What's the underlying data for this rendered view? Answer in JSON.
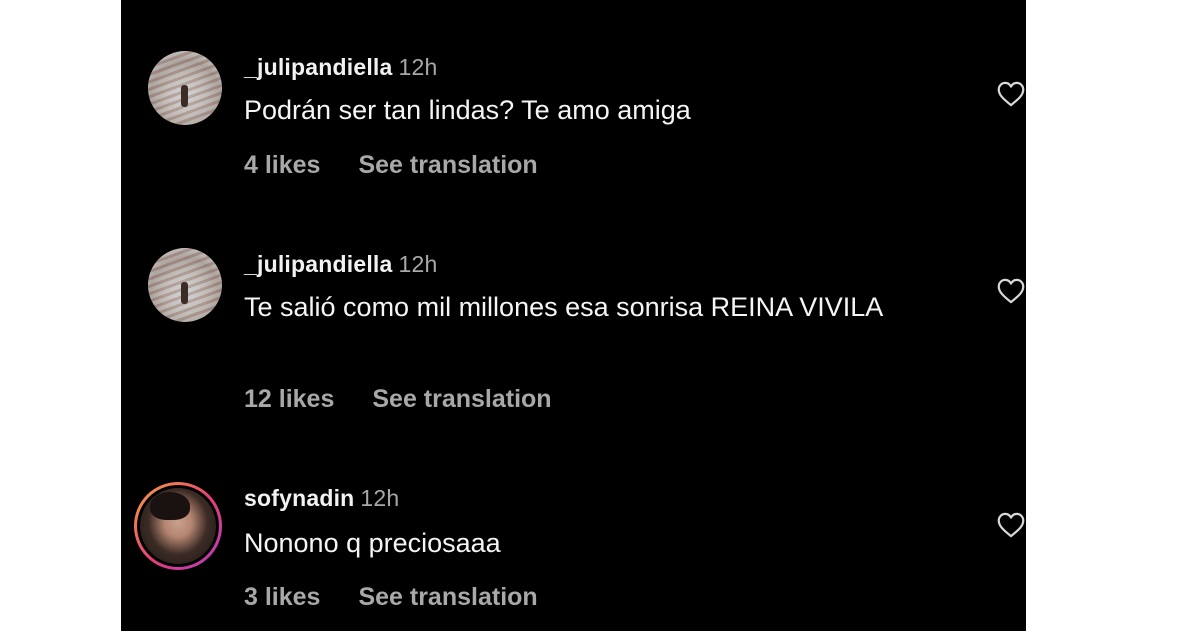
{
  "comments": [
    {
      "username": "_julipandiella",
      "time": "12h",
      "text": "Podrán ser tan lindas? Te amo amiga",
      "likes": "4 likes",
      "translate": "See translation",
      "avatar": "profile-photo-landscape"
    },
    {
      "username": "_julipandiella",
      "time": "12h",
      "text": "Te salió como mil millones esa sonrisa REINA VIVILA",
      "likes": "12 likes",
      "translate": "See translation",
      "avatar": "profile-photo-landscape"
    },
    {
      "username": "sofynadin",
      "time": "12h",
      "text": "Nonono q preciosaaa",
      "likes": "3 likes",
      "translate": "See translation",
      "avatar": "profile-photo-story-ring"
    }
  ],
  "icons": {
    "like": "heart-outline-icon"
  },
  "colors": {
    "background": "#000000",
    "primary_text": "#f5f5f5",
    "secondary_text": "#a8a8a8",
    "story_ring_start": "#f9a23d",
    "story_ring_end": "#b03ac7"
  }
}
